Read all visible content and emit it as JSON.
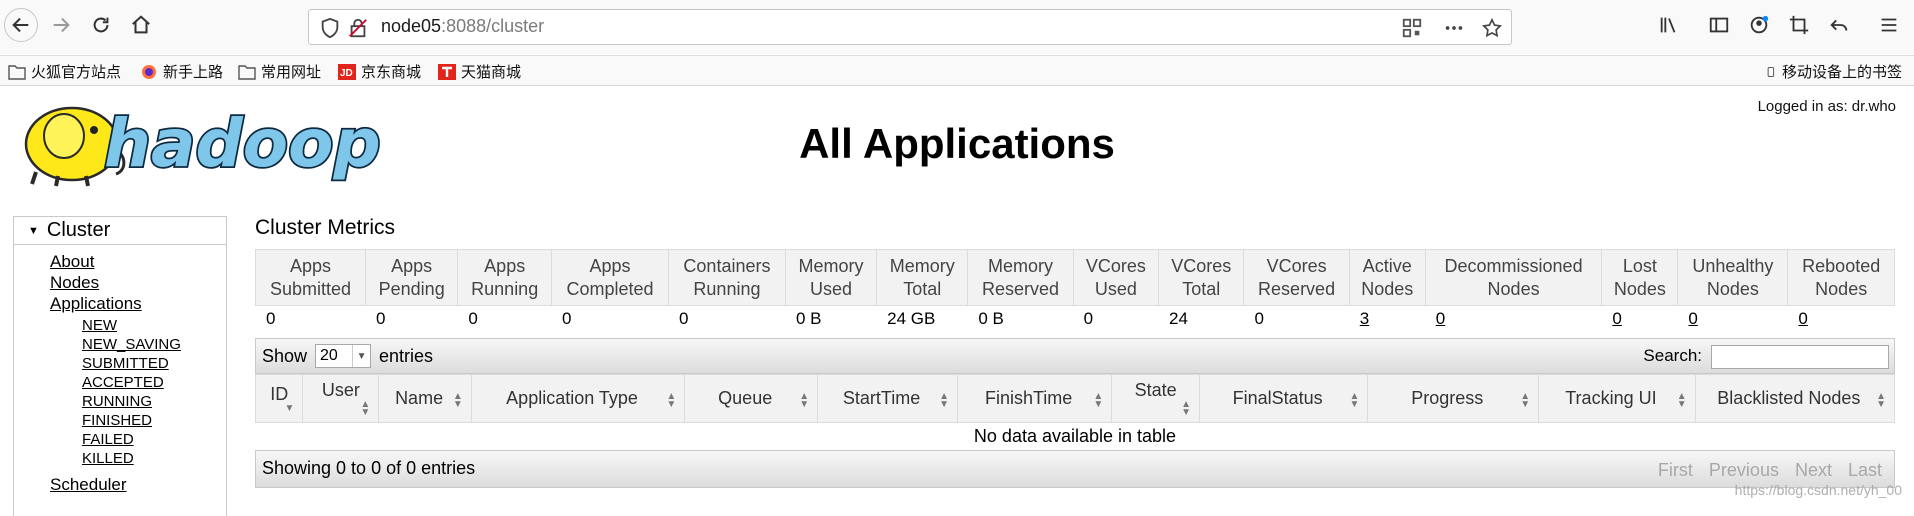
{
  "browser": {
    "url_host": "node05",
    "url_path": ":8088/cluster",
    "bookmarks": [
      "火狐官方站点",
      "新手上路",
      "常用网址",
      "京东商城",
      "天猫商城"
    ],
    "mobile_bookmarks": "移动设备上的书签"
  },
  "page": {
    "logged_in": "Logged in as: dr.who",
    "title": "All Applications",
    "logo_text": "hadoop"
  },
  "nav": {
    "header": "Cluster",
    "items": [
      "About",
      "Nodes",
      "Applications"
    ],
    "app_states": [
      "NEW",
      "NEW_SAVING",
      "SUBMITTED",
      "ACCEPTED",
      "RUNNING",
      "FINISHED",
      "FAILED",
      "KILLED"
    ],
    "scheduler": "Scheduler"
  },
  "metrics": {
    "title": "Cluster Metrics",
    "headers": [
      [
        "Apps",
        "Submitted"
      ],
      [
        "Apps",
        "Pending"
      ],
      [
        "Apps",
        "Running"
      ],
      [
        "Apps",
        "Completed"
      ],
      [
        "Containers",
        "Running"
      ],
      [
        "Memory",
        "Used"
      ],
      [
        "Memory",
        "Total"
      ],
      [
        "Memory",
        "Reserved"
      ],
      [
        "VCores",
        "Used"
      ],
      [
        "VCores",
        "Total"
      ],
      [
        "VCores",
        "Reserved"
      ],
      [
        "Active",
        "Nodes"
      ],
      [
        "Decommissioned",
        "Nodes"
      ],
      [
        "Lost",
        "Nodes"
      ],
      [
        "Unhealthy",
        "Nodes"
      ],
      [
        "Rebooted",
        "Nodes"
      ]
    ],
    "values": [
      "0",
      "0",
      "0",
      "0",
      "0",
      "0 B",
      "24 GB",
      "0 B",
      "0",
      "24",
      "0",
      "3",
      "0",
      "0",
      "0",
      "0"
    ]
  },
  "applications": {
    "show_label": "Show",
    "entries_label": "entries",
    "page_size": "20",
    "search_label": "Search:",
    "columns": [
      "ID",
      "User",
      "Name",
      "Application Type",
      "Queue",
      "StartTime",
      "FinishTime",
      "State",
      "FinalStatus",
      "Progress",
      "Tracking UI",
      "Blacklisted Nodes"
    ],
    "empty_message": "No data available in table",
    "info": "Showing 0 to 0 of 0 entries",
    "pager": [
      "First",
      "Previous",
      "Next",
      "Last"
    ]
  },
  "watermark": "https://blog.csdn.net/yh_00"
}
